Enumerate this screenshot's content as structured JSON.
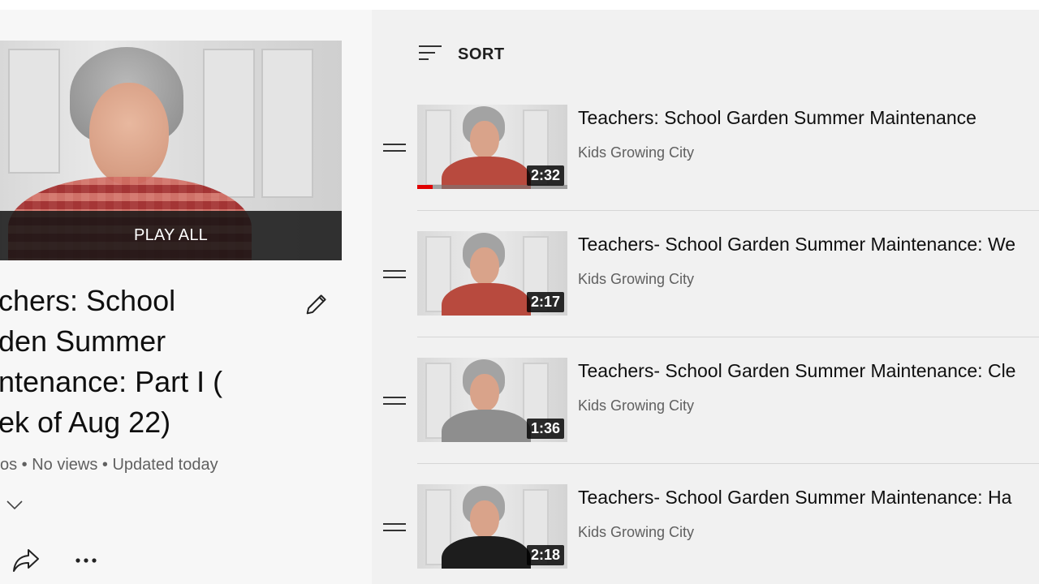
{
  "playlist": {
    "play_all_label": "PLAY ALL",
    "title": "chers: School\nden Summer\nntenance: Part I (\nek of Aug 22)",
    "meta": "os • No views • Updated today",
    "icons": {
      "edit": "pencil-icon",
      "expand": "chevron-down-icon",
      "share": "share-icon",
      "more": "more-horiz-icon"
    }
  },
  "sort": {
    "label": "SORT",
    "icon": "sort-icon"
  },
  "videos": [
    {
      "title": "Teachers: School Garden Summer Maintenance",
      "channel": "Kids Growing City",
      "duration": "2:32",
      "watched_fraction": 0.1,
      "shirt_color": "#b84a3e"
    },
    {
      "title": "Teachers- School Garden Summer Maintenance: We",
      "channel": "Kids Growing City",
      "duration": "2:17",
      "watched_fraction": 0,
      "shirt_color": "#b84a3e"
    },
    {
      "title": "Teachers- School Garden Summer Maintenance: Cle",
      "channel": "Kids Growing City",
      "duration": "1:36",
      "watched_fraction": 0,
      "shirt_color": "#8e8e8e"
    },
    {
      "title": "Teachers- School Garden Summer Maintenance: Ha",
      "channel": "Kids Growing City",
      "duration": "2:18",
      "watched_fraction": 0,
      "shirt_color": "#1d1d1d"
    }
  ],
  "colors": {
    "progress": "#e00000",
    "left_bg": "#f7f7f7",
    "right_bg": "#f1f1f1"
  }
}
